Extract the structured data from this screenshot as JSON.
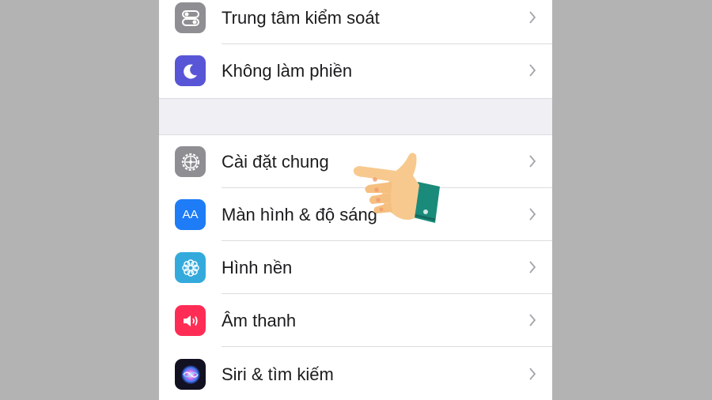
{
  "settings": {
    "items": [
      {
        "label": "Trung tâm kiểm soát",
        "icon": "control-center-icon",
        "color": "#8e8e93"
      },
      {
        "label": "Không làm phiền",
        "icon": "moon-icon",
        "color": "#5856d6"
      },
      {
        "label": "Cài đặt chung",
        "icon": "gear-icon",
        "color": "#8e8e93"
      },
      {
        "label": "Màn hình & độ sáng",
        "icon": "display-aa-icon",
        "color": "#1e7cf6"
      },
      {
        "label": "Hình nền",
        "icon": "flower-icon",
        "color": "#34aadc"
      },
      {
        "label": "Âm thanh",
        "icon": "speaker-icon",
        "color": "#ff2d55"
      },
      {
        "label": "Siri & tìm kiếm",
        "icon": "siri-icon",
        "color": "#1a1a2e"
      }
    ],
    "display_icon_text": "AA"
  },
  "overlay": {
    "icon": "pointing-hand-icon"
  }
}
